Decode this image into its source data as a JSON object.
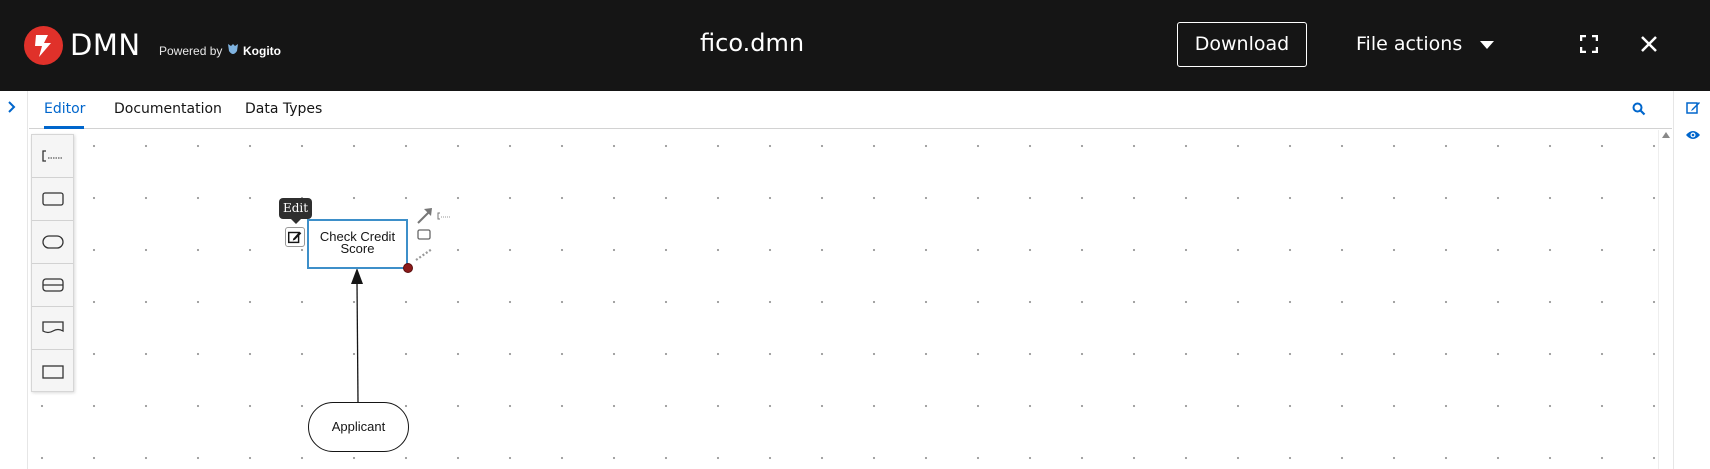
{
  "header": {
    "brand": "DMN",
    "powered_by": "Powered by",
    "powered_name": "Kogito",
    "file_name": "fico.dmn",
    "download_label": "Download",
    "file_actions_label": "File actions",
    "brand_color": "#e0312a",
    "background": "#151515"
  },
  "tabs": [
    {
      "label": "Editor",
      "active": true
    },
    {
      "label": "Documentation",
      "active": false
    },
    {
      "label": "Data Types",
      "active": false
    }
  ],
  "palette": {
    "items": [
      {
        "icon": "text-annotation-icon"
      },
      {
        "icon": "decision-icon"
      },
      {
        "icon": "input-data-icon"
      },
      {
        "icon": "business-knowledge-model-icon"
      },
      {
        "icon": "knowledge-source-icon"
      },
      {
        "icon": "decision-service-icon"
      }
    ]
  },
  "diagram": {
    "decision_label_line1": "Check Credit",
    "decision_label_line2": "Score",
    "input_label": "Applicant",
    "edit_tooltip": "Edit",
    "accent_color": "#0066cc",
    "node_border_color": "#3d8fc9"
  }
}
